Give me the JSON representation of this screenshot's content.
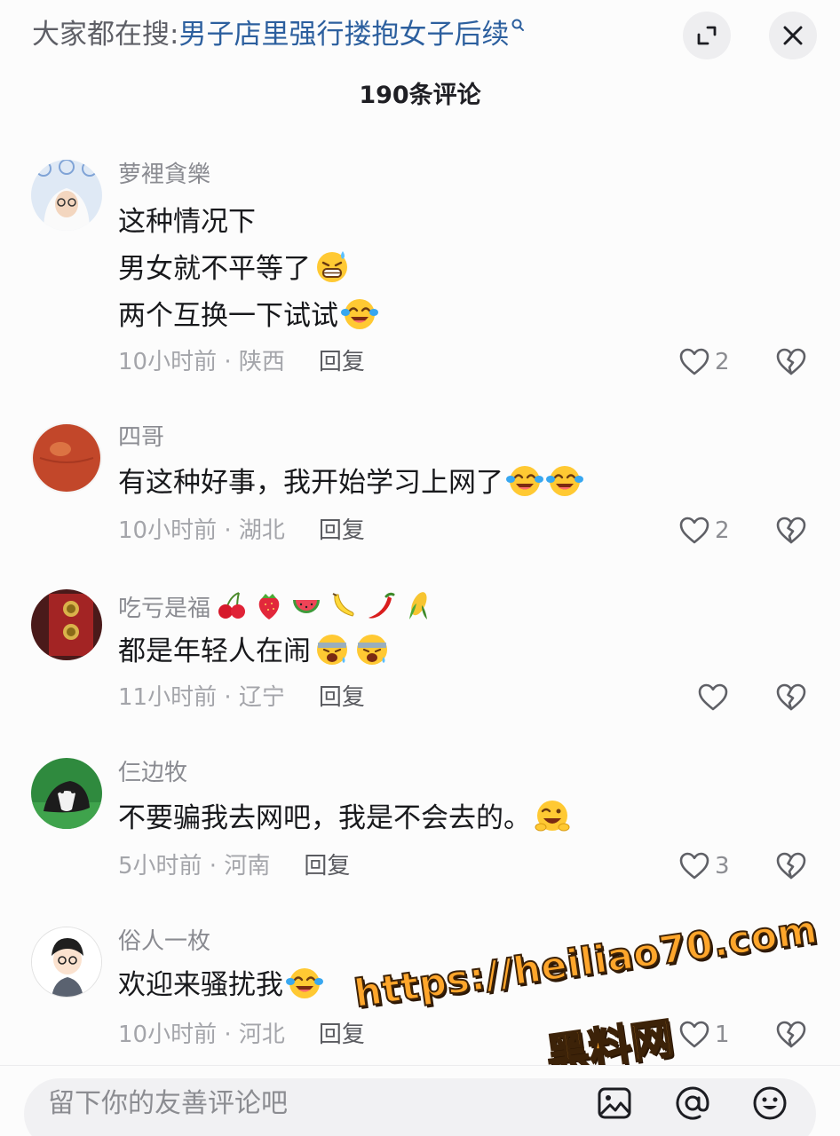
{
  "header": {
    "search_prefix": "大家都在搜:",
    "search_query": "男子店里强行搂抱女子后续",
    "expand_icon": "expand-icon",
    "close_icon": "close-icon"
  },
  "comment_count": "190条评论",
  "comments": [
    {
      "username": "萝裡貪樂",
      "lines": [
        "这种情况下",
        "男女就不平等了",
        "两个互换一下试试"
      ],
      "time_location": "10小时前 · 陕西",
      "reply": "回复",
      "likes": "2"
    },
    {
      "username": "四哥",
      "lines": [
        "有这种好事，我开始学习上网了"
      ],
      "time_location": "10小时前 · 湖北",
      "reply": "回复",
      "likes": "2"
    },
    {
      "username": "吃亏是福",
      "username_emojis": [
        "cherries",
        "strawberry",
        "watermelon",
        "banana",
        "hot-pepper",
        "corn"
      ],
      "lines": [
        "都是年轻人在闹"
      ],
      "time_location": "11小时前 · 辽宁",
      "reply": "回复",
      "likes": ""
    },
    {
      "username": "仨边牧",
      "lines": [
        "不要骗我去网吧，我是不会去的。"
      ],
      "time_location": "5小时前 · 河南",
      "reply": "回复",
      "likes": "3"
    },
    {
      "username": "俗人一枚",
      "lines": [
        "欢迎来骚扰我"
      ],
      "time_location": "10小时前 · 河北",
      "reply": "回复",
      "likes": "1"
    }
  ],
  "watermark": {
    "url": "https://heiliao70.com",
    "name": "黑料网"
  },
  "input": {
    "placeholder": "留下你的友善评论吧",
    "icons": [
      "image-icon",
      "at-icon",
      "emoji-icon"
    ]
  },
  "colors": {
    "query_link": "#2c5f9e",
    "muted_text": "#8a8b91",
    "watermark": "#ffa62b"
  }
}
